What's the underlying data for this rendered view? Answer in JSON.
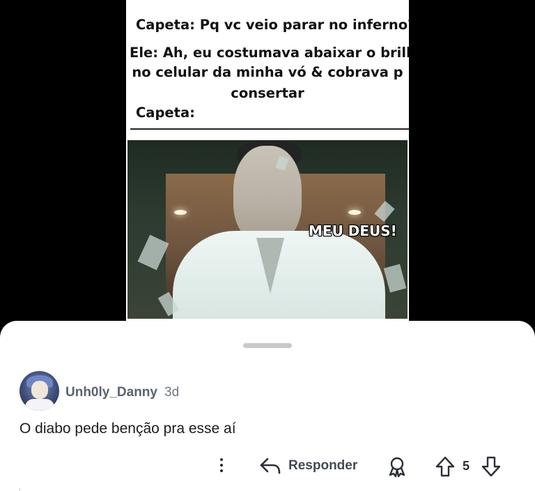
{
  "meme": {
    "lines": [
      "Capeta: Pq vc veio parar no inferno?",
      "Ele: Ah, eu costumava abaixar o brilho",
      "no celular da minha vó & cobrava p",
      "consertar",
      "Capeta:"
    ],
    "caption": "MEU DEUS!"
  },
  "comment": {
    "username": "Unh0ly_Danny",
    "time": "3d",
    "text": "O diabo pede benção pra esse aí"
  },
  "actions": {
    "reply_label": "Responder",
    "score": "5",
    "icons": {
      "more": "more-vertical-icon",
      "reply": "reply-arrow-icon",
      "award": "award-icon",
      "upvote": "upvote-arrow-icon",
      "downvote": "downvote-arrow-icon"
    }
  },
  "colors": {
    "sheet_background": "#ffffff",
    "page_background": "#000000",
    "username": "#5a6270",
    "text": "#1c1c1c"
  }
}
